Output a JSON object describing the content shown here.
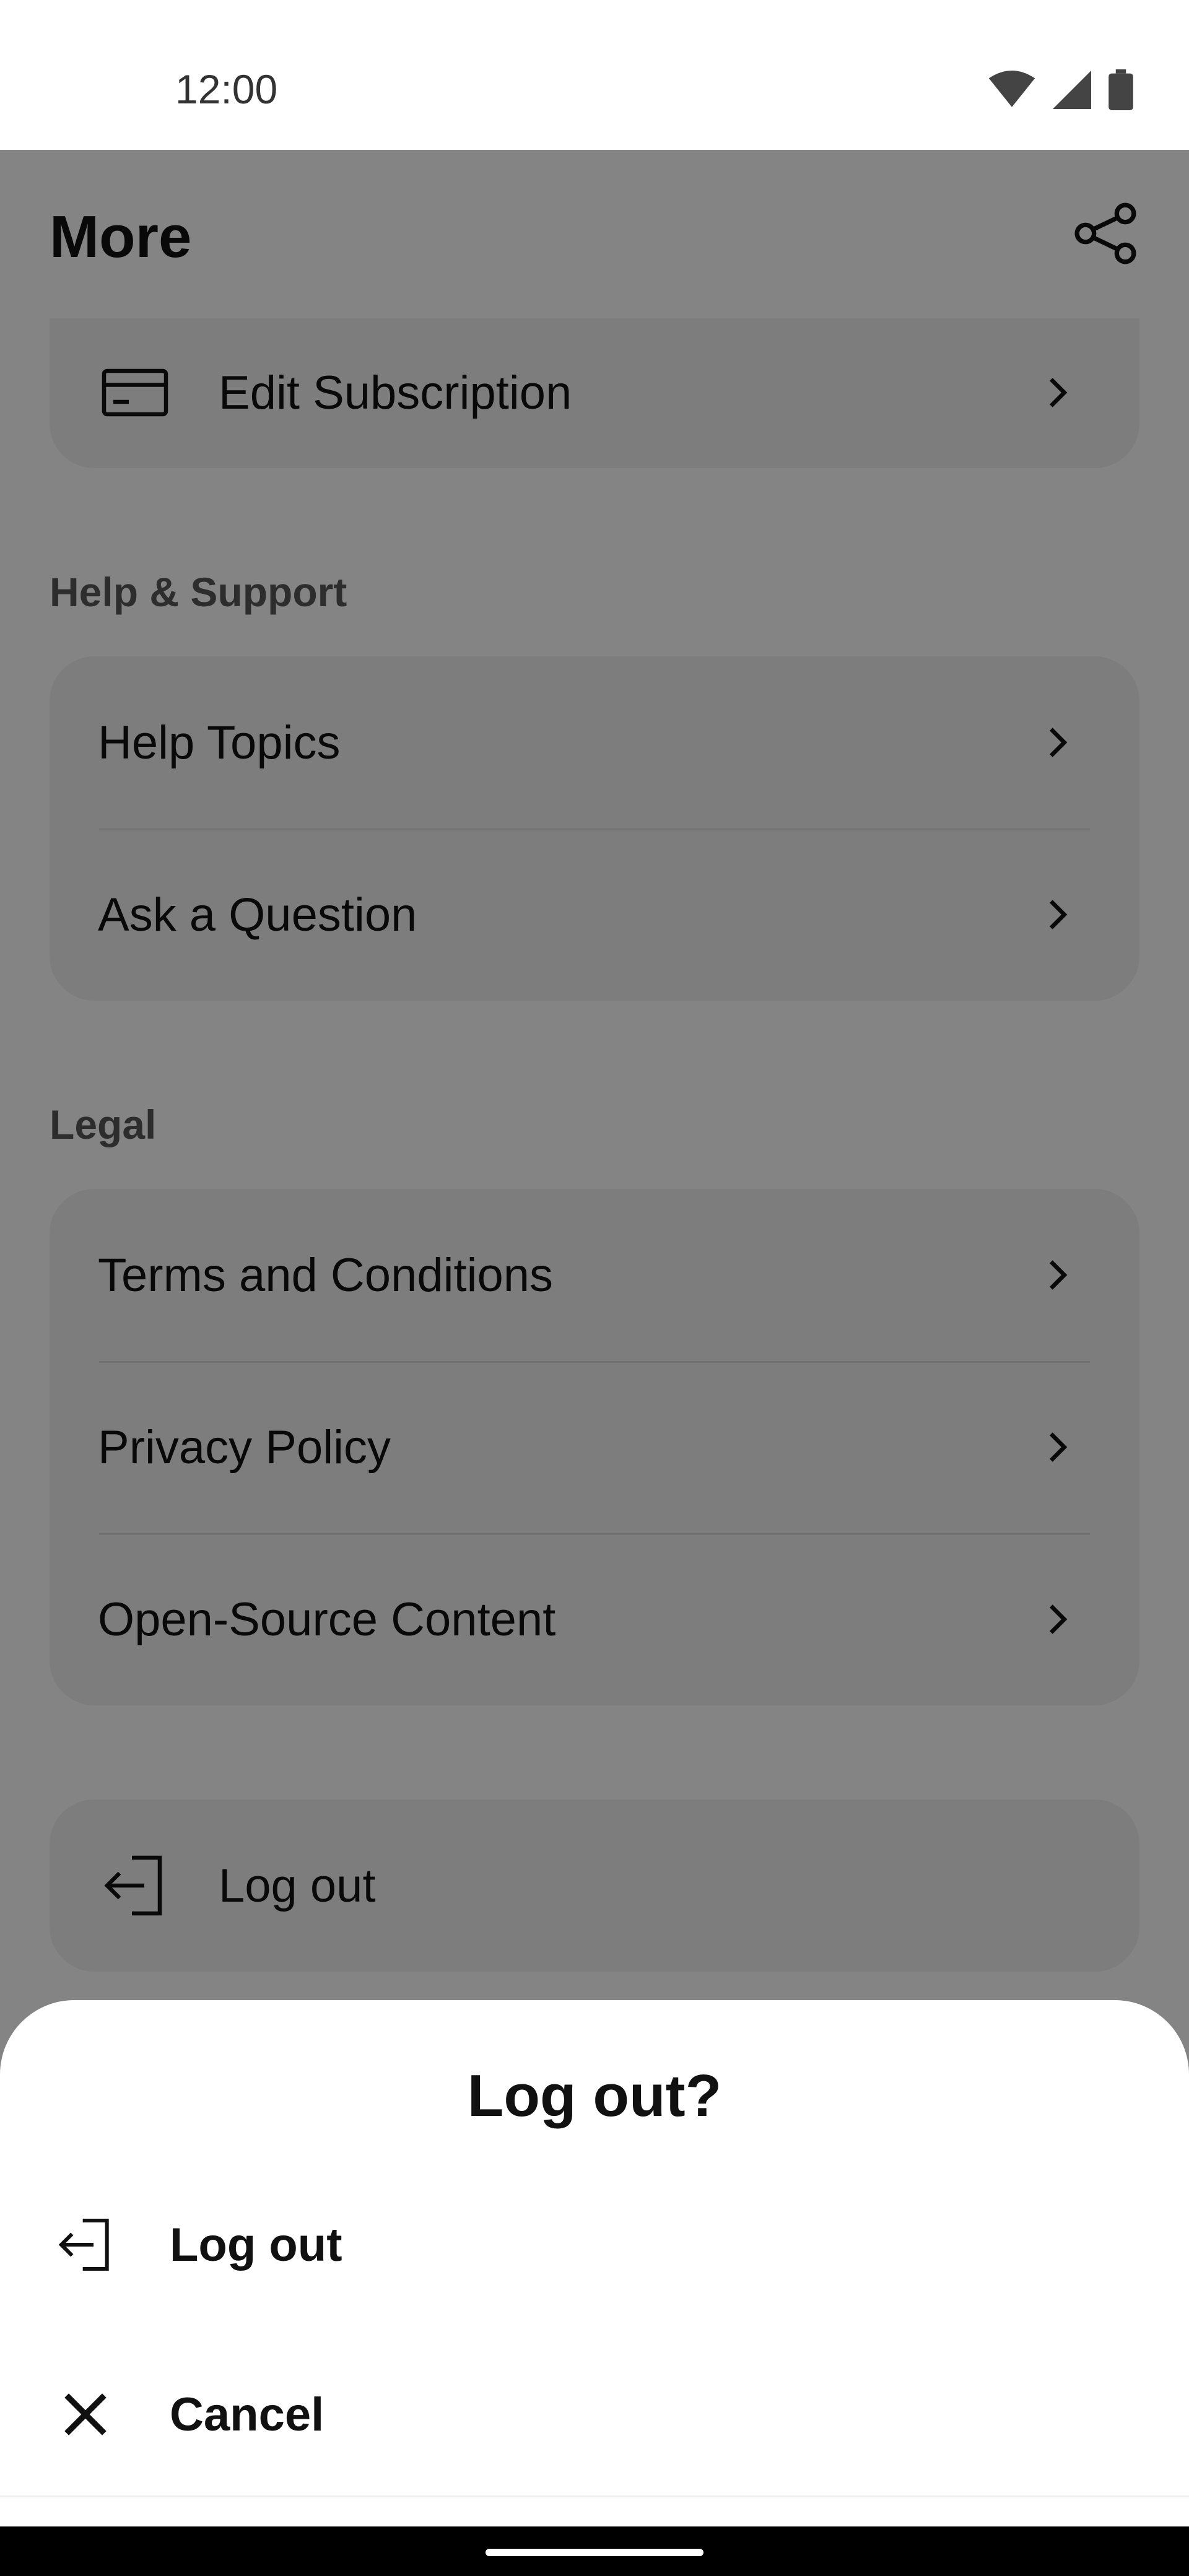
{
  "status_bar": {
    "time": "12:00",
    "icons": [
      "wifi-icon",
      "cellular-signal-icon",
      "battery-icon"
    ]
  },
  "header": {
    "title": "More",
    "share_icon": "share-icon"
  },
  "account_card": {
    "items": [
      {
        "label": "Edit Subscription",
        "icon": "credit-card-icon"
      }
    ]
  },
  "help_section": {
    "title": "Help & Support",
    "items": [
      {
        "label": "Help Topics"
      },
      {
        "label": "Ask a Question"
      }
    ]
  },
  "legal_section": {
    "title": "Legal",
    "items": [
      {
        "label": "Terms and Conditions"
      },
      {
        "label": "Privacy Policy"
      },
      {
        "label": "Open-Source Content"
      }
    ]
  },
  "logout_card": {
    "label": "Log out",
    "icon": "logout-icon"
  },
  "dialog": {
    "title": "Log out?",
    "confirm_label": "Log out",
    "cancel_label": "Cancel"
  },
  "colors": {
    "scrim": "#000000",
    "card": "#ececec",
    "sheet": "#ffffff"
  }
}
